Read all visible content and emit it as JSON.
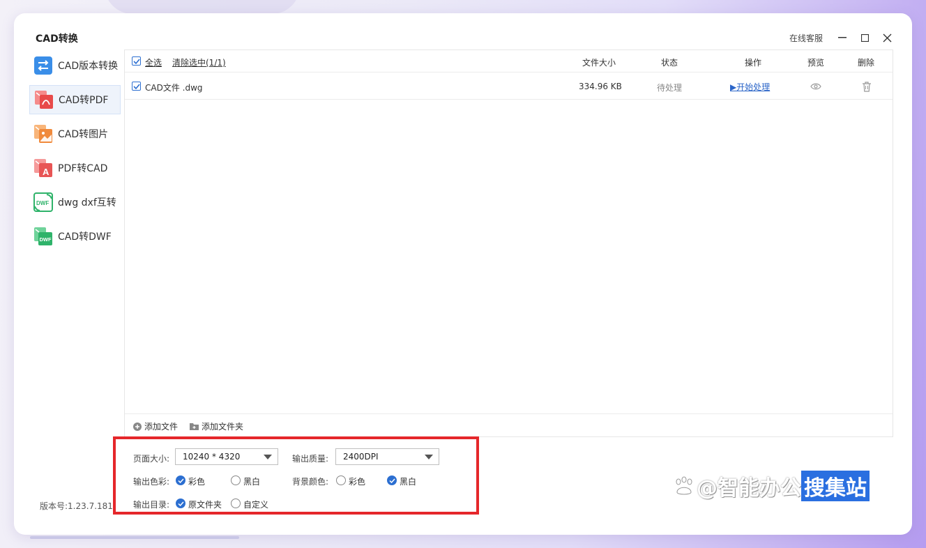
{
  "window": {
    "title": "CAD转换",
    "service_label": "在线客服"
  },
  "sidebar": {
    "items": [
      {
        "label": "CAD版本转换",
        "icon": "version-convert-icon"
      },
      {
        "label": "CAD转PDF",
        "icon": "pdf-icon",
        "active": true
      },
      {
        "label": "CAD转图片",
        "icon": "image-icon"
      },
      {
        "label": "PDF转CAD",
        "icon": "pdf-to-cad-icon"
      },
      {
        "label": "dwg dxf互转",
        "icon": "dwf-icon"
      },
      {
        "label": "CAD转DWF",
        "icon": "dwf-green-icon"
      }
    ],
    "version": "版本号:1.23.7.181"
  },
  "table": {
    "select_all": "全选",
    "clear_selection": "清除选中(1/1)",
    "headers": {
      "size": "文件大小",
      "status": "状态",
      "action": "操作",
      "preview": "预览",
      "delete": "删除"
    },
    "rows": [
      {
        "name": "CAD文件 .dwg",
        "size": "334.96 KB",
        "status": "待处理",
        "action": "▶开始处理"
      }
    ],
    "add_file": "添加文件",
    "add_folder": "添加文件夹"
  },
  "settings": {
    "page_size_label": "页面大小:",
    "page_size_value": "10240 * 4320",
    "quality_label": "输出质量:",
    "quality_value": "2400DPI",
    "color_label": "输出色彩:",
    "color_options": [
      "彩色",
      "黑白"
    ],
    "color_selected": "彩色",
    "bg_label": "背景颜色:",
    "bg_options": [
      "彩色",
      "黑白"
    ],
    "bg_selected": "黑白",
    "dir_label": "输出目录:",
    "dir_options": [
      "原文件夹",
      "自定义"
    ],
    "dir_selected": "原文件夹"
  },
  "watermark": {
    "text_a": "@智能办公",
    "text_b": "搜集站"
  },
  "colors": {
    "accent": "#2c6fd1",
    "highlight_border": "#e5272b",
    "link": "#2b65c8"
  }
}
